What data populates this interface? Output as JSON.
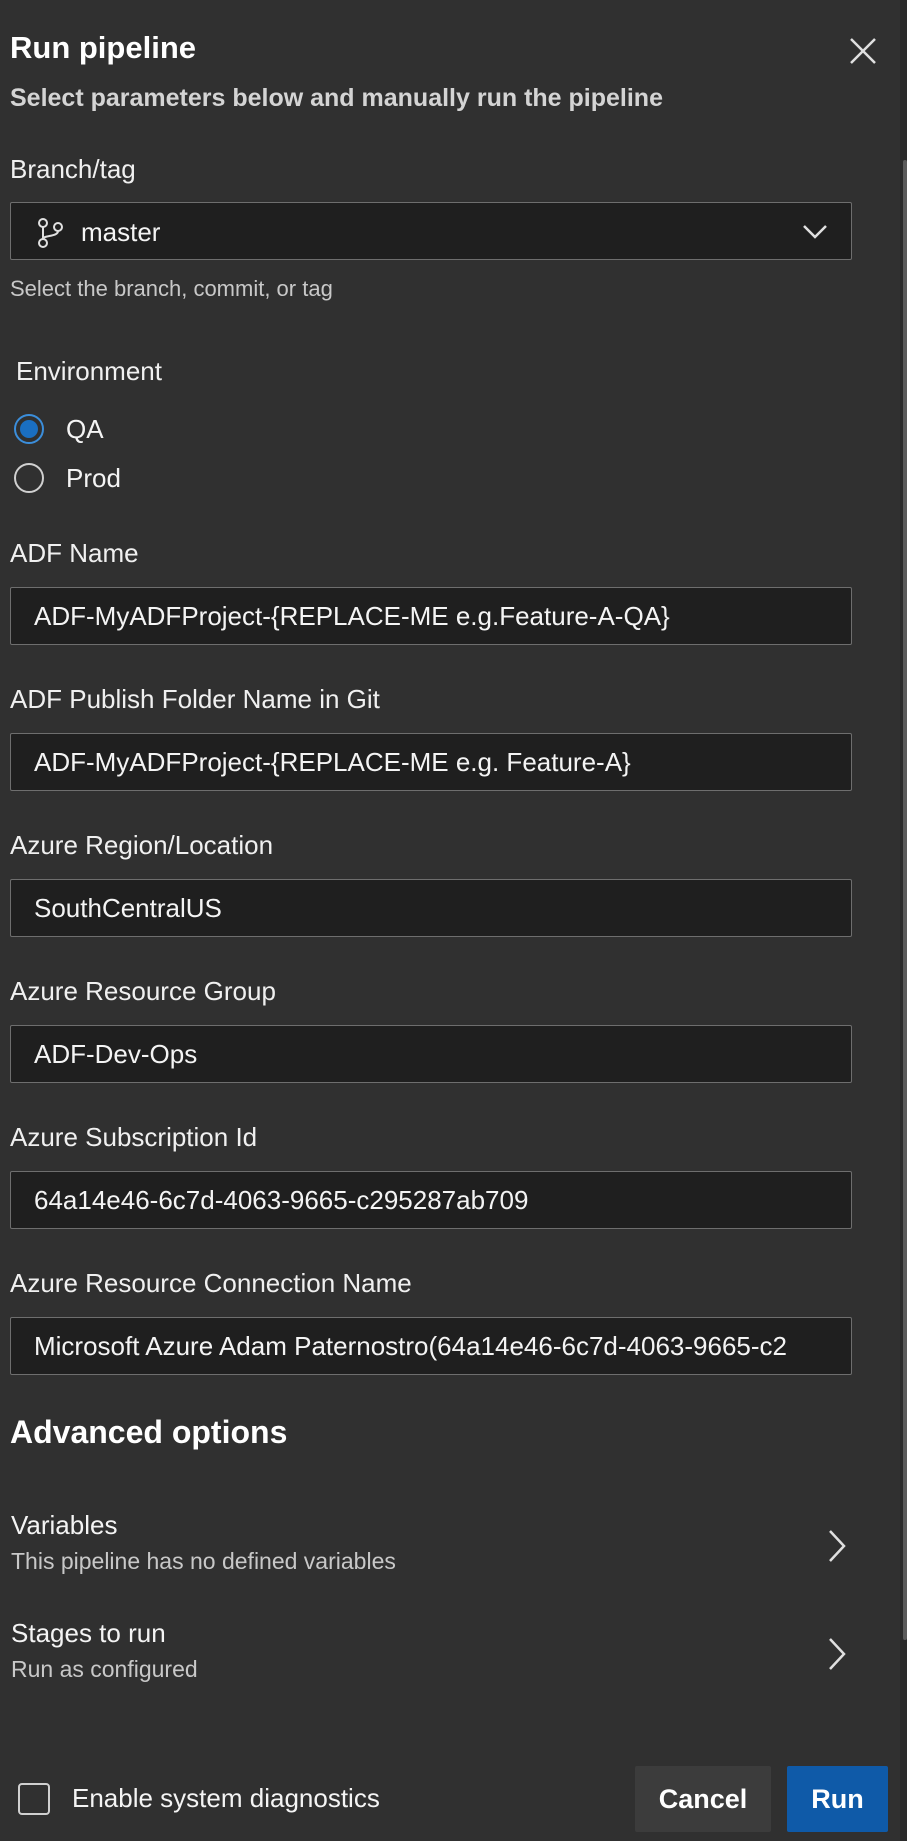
{
  "dialog": {
    "title": "Run pipeline",
    "subtitle": "Select parameters below and manually run the pipeline",
    "close_icon": "close-icon"
  },
  "branch": {
    "label": "Branch/tag",
    "value": "master",
    "hint": "Select the branch, commit, or tag",
    "icon": "branch-icon"
  },
  "environment": {
    "label": "Environment",
    "options": [
      {
        "label": "QA",
        "checked": true
      },
      {
        "label": "Prod",
        "checked": false
      }
    ]
  },
  "fields": {
    "adf_name": {
      "label": "ADF Name",
      "value": "ADF-MyADFProject-{REPLACE-ME e.g.Feature-A-QA}"
    },
    "publish_folder": {
      "label": "ADF Publish Folder Name in Git",
      "value": "ADF-MyADFProject-{REPLACE-ME e.g. Feature-A}"
    },
    "region": {
      "label": "Azure Region/Location",
      "value": "SouthCentralUS"
    },
    "resource_group": {
      "label": "Azure Resource Group",
      "value": "ADF-Dev-Ops"
    },
    "subscription_id": {
      "label": "Azure Subscription Id",
      "value": "64a14e46-6c7d-4063-9665-c295287ab709"
    },
    "connection_name": {
      "label": "Azure Resource Connection Name",
      "value": "Microsoft Azure Adam Paternostro(64a14e46-6c7d-4063-9665-c2"
    }
  },
  "advanced": {
    "title": "Advanced options",
    "variables": {
      "title": "Variables",
      "subtitle": "This pipeline has no defined variables"
    },
    "stages": {
      "title": "Stages to run",
      "subtitle": "Run as configured"
    }
  },
  "footer": {
    "diagnostics_label": "Enable system diagnostics",
    "diagnostics_checked": false,
    "cancel_label": "Cancel",
    "run_label": "Run"
  },
  "colors": {
    "background": "#303030",
    "input_background": "#1f1f1f",
    "accent": "#0f5aa8",
    "radio_selected": "#1a6fc2"
  }
}
